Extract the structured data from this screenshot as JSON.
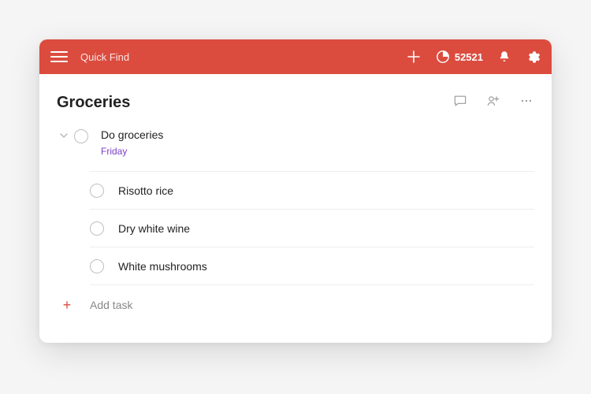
{
  "topbar": {
    "quickfind_placeholder": "Quick Find",
    "karma_count": "52521"
  },
  "project": {
    "title": "Groceries"
  },
  "parent_task": {
    "title": "Do groceries",
    "due": "Friday"
  },
  "subtasks": [
    {
      "title": "Risotto rice"
    },
    {
      "title": "Dry white wine"
    },
    {
      "title": "White mushrooms"
    }
  ],
  "add_task_label": "Add task"
}
